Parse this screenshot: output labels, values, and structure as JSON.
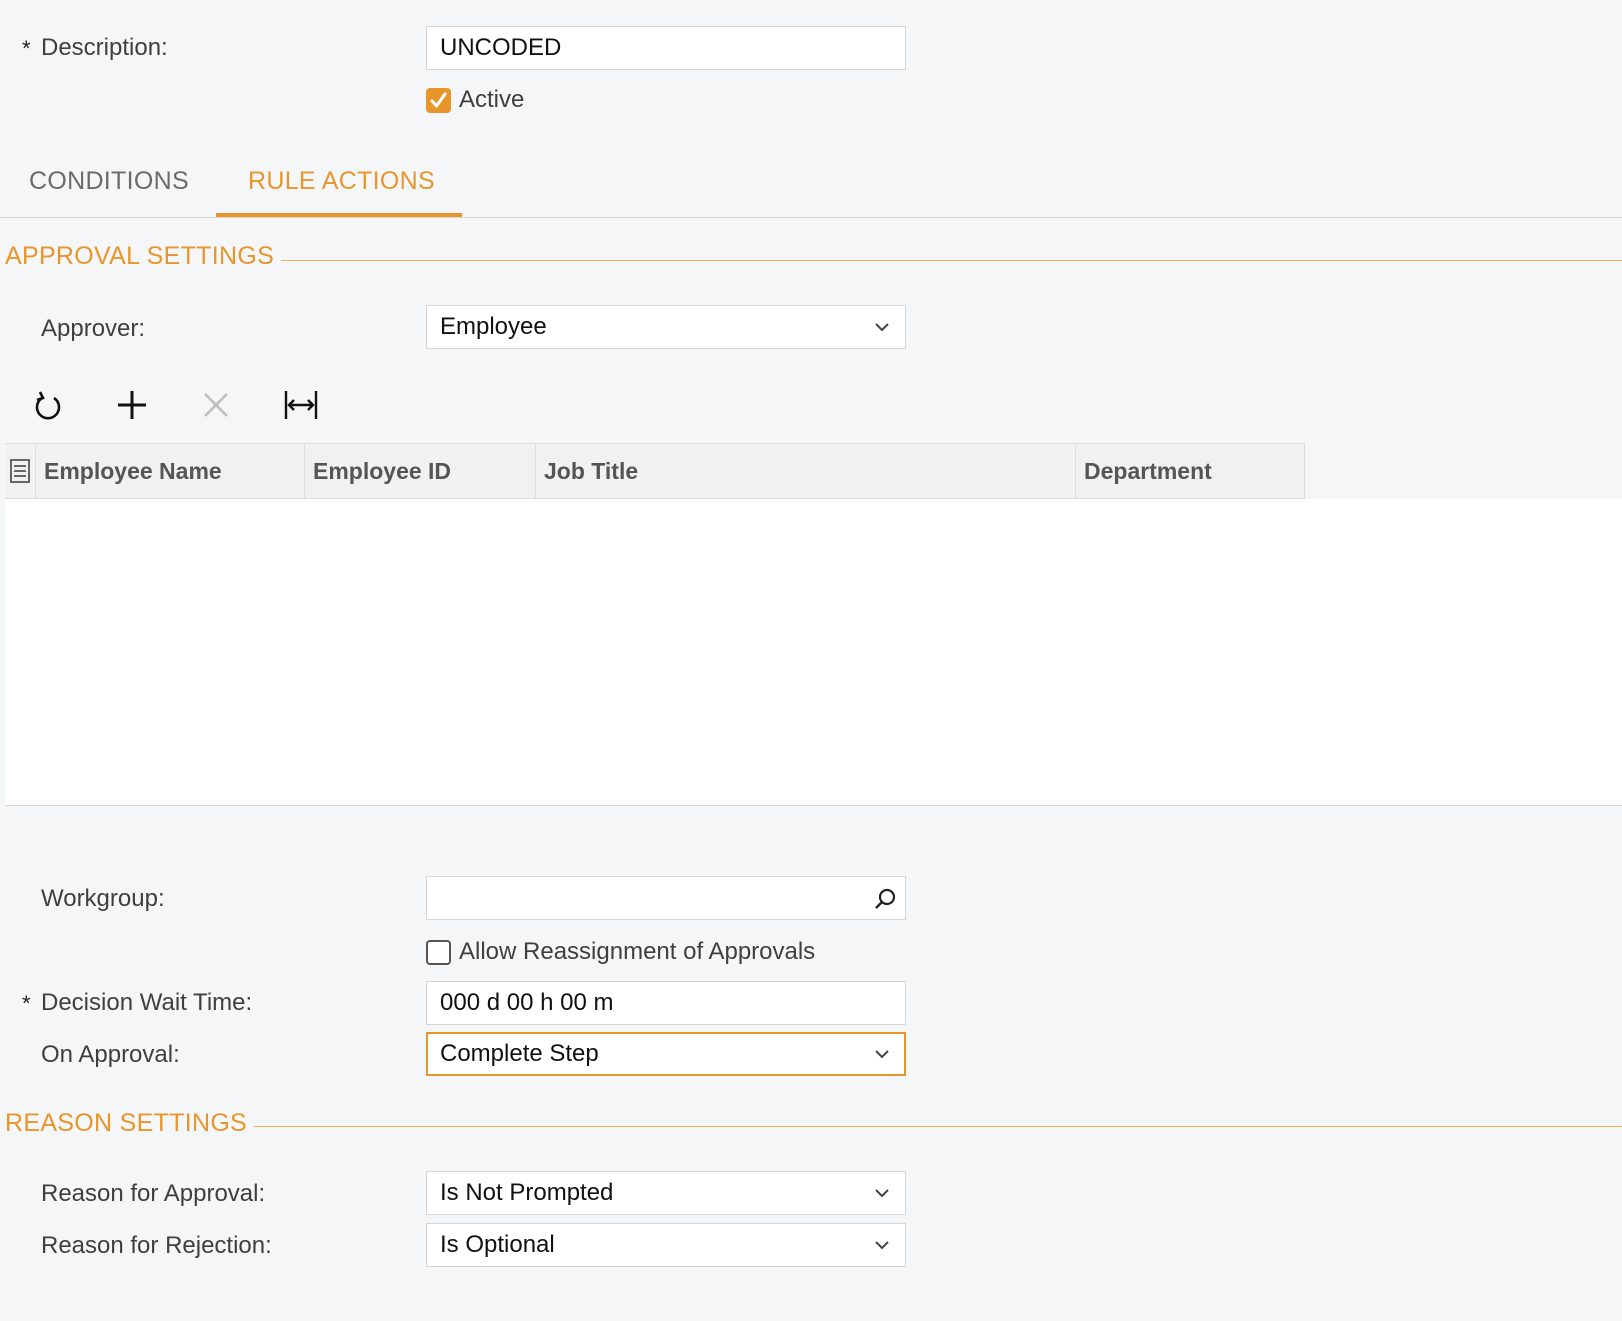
{
  "form": {
    "description_label": "Description:",
    "description_value": "UNCODED",
    "active_label": "Active",
    "active_checked": true,
    "required_mark": "*"
  },
  "tabs": [
    {
      "label": "CONDITIONS",
      "active": false
    },
    {
      "label": "RULE ACTIONS",
      "active": true
    }
  ],
  "approval_settings": {
    "title": "APPROVAL SETTINGS",
    "approver_label": "Approver:",
    "approver_value": "Employee",
    "toolbar": {
      "refresh_icon": "refresh-icon",
      "add_icon": "plus-icon",
      "delete_icon": "close-icon",
      "fit_icon": "fit-columns-icon"
    },
    "grid": {
      "columns": [
        "Employee Name",
        "Employee ID",
        "Job Title",
        "Department"
      ],
      "rows": []
    },
    "workgroup_label": "Workgroup:",
    "workgroup_value": "",
    "allow_reassign_label": "Allow Reassignment of Approvals",
    "allow_reassign_checked": false,
    "wait_time_label": "Decision Wait Time:",
    "wait_time_value": "000 d 00 h 00 m",
    "on_approval_label": "On Approval:",
    "on_approval_value": "Complete Step"
  },
  "reason_settings": {
    "title": "REASON SETTINGS",
    "approval_label": "Reason for Approval:",
    "approval_value": "Is Not Prompted",
    "rejection_label": "Reason for Rejection:",
    "rejection_value": "Is Optional"
  },
  "colors": {
    "accent": "#e8962b",
    "background": "#f5f6f7"
  }
}
